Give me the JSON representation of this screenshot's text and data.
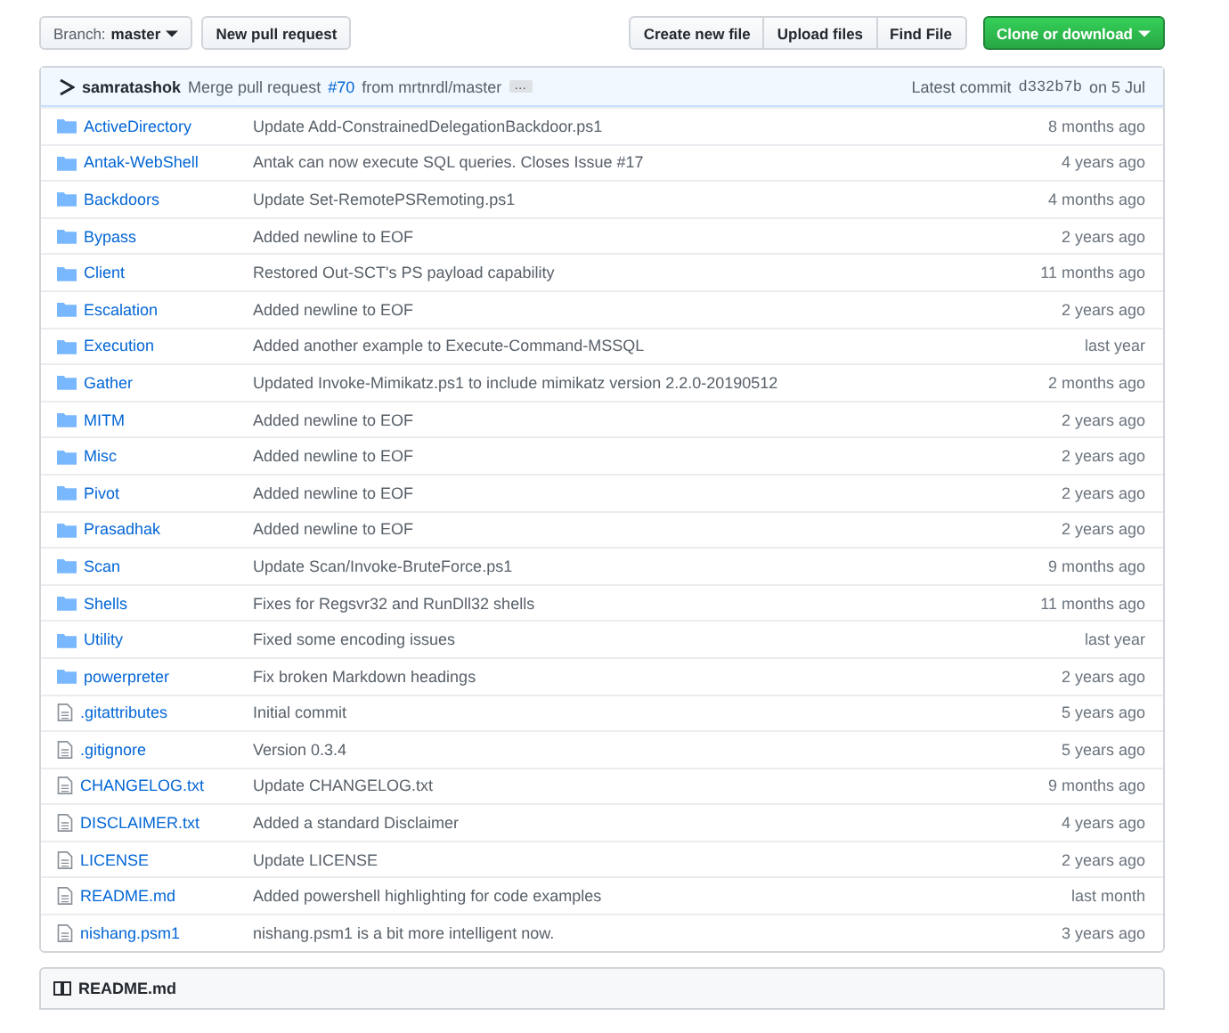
{
  "toolbar": {
    "branch_label": "Branch:",
    "branch": "master",
    "new_pull_request": "New pull request",
    "file_buttons": [
      "Create new file",
      "Upload files",
      "Find File"
    ],
    "clone_button": "Clone or download"
  },
  "latest_commit": {
    "author": "samratashok",
    "message_prefix": "Merge pull request",
    "pr_link": "#70",
    "message_suffix": "from mrtnrdl/master",
    "ellipsis": "…",
    "label": "Latest commit",
    "sha": "d332b7b",
    "date": "on 5 Jul"
  },
  "files": [
    {
      "kind": "folder",
      "name": "ActiveDirectory",
      "message": "Update Add-ConstrainedDelegationBackdoor.ps1",
      "age": "8 months ago"
    },
    {
      "kind": "folder",
      "name": "Antak-WebShell",
      "message": "Antak can now execute SQL queries. Closes Issue #17",
      "age": "4 years ago"
    },
    {
      "kind": "folder",
      "name": "Backdoors",
      "message": "Update Set-RemotePSRemoting.ps1",
      "age": "4 months ago"
    },
    {
      "kind": "folder",
      "name": "Bypass",
      "message": "Added newline to EOF",
      "age": "2 years ago"
    },
    {
      "kind": "folder",
      "name": "Client",
      "message": "Restored Out-SCT's PS payload capability",
      "age": "11 months ago"
    },
    {
      "kind": "folder",
      "name": "Escalation",
      "message": "Added newline to EOF",
      "age": "2 years ago"
    },
    {
      "kind": "folder",
      "name": "Execution",
      "message": "Added another example to Execute-Command-MSSQL",
      "age": "last year"
    },
    {
      "kind": "folder",
      "name": "Gather",
      "message": "Updated Invoke-Mimikatz.ps1 to include mimikatz version 2.2.0-20190512",
      "age": "2 months ago"
    },
    {
      "kind": "folder",
      "name": "MITM",
      "message": "Added newline to EOF",
      "age": "2 years ago"
    },
    {
      "kind": "folder",
      "name": "Misc",
      "message": "Added newline to EOF",
      "age": "2 years ago"
    },
    {
      "kind": "folder",
      "name": "Pivot",
      "message": "Added newline to EOF",
      "age": "2 years ago"
    },
    {
      "kind": "folder",
      "name": "Prasadhak",
      "message": "Added newline to EOF",
      "age": "2 years ago"
    },
    {
      "kind": "folder",
      "name": "Scan",
      "message": "Update Scan/Invoke-BruteForce.ps1",
      "age": "9 months ago"
    },
    {
      "kind": "folder",
      "name": "Shells",
      "message": "Fixes for Regsvr32 and RunDll32 shells",
      "age": "11 months ago"
    },
    {
      "kind": "folder",
      "name": "Utility",
      "message": "Fixed some encoding issues",
      "age": "last year"
    },
    {
      "kind": "folder",
      "name": "powerpreter",
      "message": "Fix broken Markdown headings",
      "age": "2 years ago"
    },
    {
      "kind": "file",
      "name": ".gitattributes",
      "message": "Initial commit",
      "age": "5 years ago"
    },
    {
      "kind": "file",
      "name": ".gitignore",
      "message": "Version 0.3.4",
      "age": "5 years ago"
    },
    {
      "kind": "file",
      "name": "CHANGELOG.txt",
      "message": "Update CHANGELOG.txt",
      "age": "9 months ago"
    },
    {
      "kind": "file",
      "name": "DISCLAIMER.txt",
      "message": "Added a standard Disclaimer",
      "age": "4 years ago"
    },
    {
      "kind": "file",
      "name": "LICENSE",
      "message": "Update LICENSE",
      "age": "2 years ago"
    },
    {
      "kind": "file",
      "name": "README.md",
      "message": "Added powershell highlighting for code examples",
      "age": "last month"
    },
    {
      "kind": "file",
      "name": "nishang.psm1",
      "message": "nishang.psm1 is a bit more intelligent now.",
      "age": "3 years ago"
    }
  ],
  "readme": {
    "title": "README.md"
  }
}
